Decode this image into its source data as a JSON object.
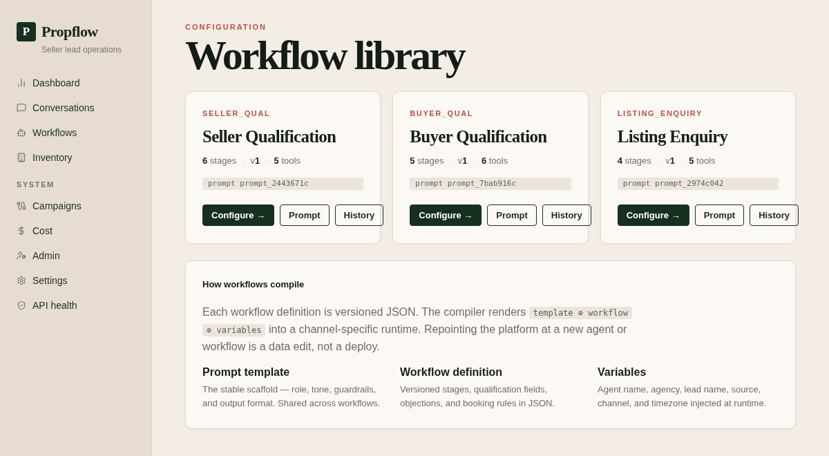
{
  "sidebar": {
    "brand": {
      "logo_letter": "P",
      "name": "Propflow",
      "tagline": "Seller lead operations"
    },
    "sections": [
      {
        "items": [
          {
            "label": "Dashboard",
            "selected": false
          },
          {
            "label": "Conversations",
            "selected": false
          },
          {
            "label": "Workflows",
            "selected": false
          },
          {
            "label": "Inventory",
            "selected": false
          }
        ]
      },
      {
        "heading": "SYSTEM",
        "items": [
          {
            "label": "Campaigns",
            "selected": false
          },
          {
            "label": "Cost",
            "selected": false
          },
          {
            "label": "Admin",
            "selected": false
          },
          {
            "label": "Settings",
            "selected": false
          },
          {
            "label": "API health",
            "selected": false
          }
        ]
      }
    ]
  },
  "header": {
    "eyebrow": "CONFIGURATION",
    "title": "Workflow library"
  },
  "workflows": [
    {
      "key": "SELLER_QUAL",
      "name": "Seller Qualification",
      "meta": [
        {
          "kind": "stat",
          "text": "**6** stages"
        },
        {
          "kind": "separator",
          "text": "·"
        },
        {
          "kind": "stat",
          "text": "v**1**"
        },
        {
          "kind": "separator",
          "text": "·"
        },
        {
          "kind": "stat",
          "text": "**5** tools"
        }
      ],
      "prompt": "prompt prompt_2443671c",
      "actions": [
        {
          "kind": "primary",
          "label": "Configure →"
        },
        {
          "kind": "secondary",
          "label": "Prompt"
        },
        {
          "kind": "secondary",
          "label": "History"
        }
      ]
    },
    {
      "key": "BUYER_QUAL",
      "name": "Buyer Qualification",
      "meta": [
        {
          "kind": "stat",
          "text": "**5** stages"
        },
        {
          "kind": "separator",
          "text": "·"
        },
        {
          "kind": "stat",
          "text": "v**1**"
        },
        {
          "kind": "separator",
          "text": "·"
        },
        {
          "kind": "stat",
          "text": "**6** tools"
        }
      ],
      "prompt": "prompt prompt_7bab916c",
      "actions": [
        {
          "kind": "primary",
          "label": "Configure →"
        },
        {
          "kind": "secondary",
          "label": "Prompt"
        },
        {
          "kind": "secondary",
          "label": "History"
        }
      ]
    },
    {
      "key": "LISTING_ENQUIRY",
      "name": "Listing Enquiry",
      "meta": [
        {
          "kind": "stat",
          "text": "**4** stages"
        },
        {
          "kind": "separator",
          "text": "·"
        },
        {
          "kind": "stat",
          "text": "v**1**"
        },
        {
          "kind": "separator",
          "text": "·"
        },
        {
          "kind": "stat",
          "text": "**5** tools"
        }
      ],
      "prompt": "prompt prompt_2974c042",
      "actions": [
        {
          "kind": "primary",
          "label": "Configure →"
        },
        {
          "kind": "secondary",
          "label": "Prompt"
        },
        {
          "kind": "secondary",
          "label": "History"
        }
      ]
    }
  ],
  "info": {
    "title": "How workflows compile",
    "body": [
      {
        "kind": "text",
        "text": "Each workflow definition is versioned JSON. The compiler renders "
      },
      {
        "kind": "code",
        "text": "template ⊕ workflow ⊕ variables"
      },
      {
        "kind": "text",
        "text": " into a channel-specific runtime. Repointing the platform at a new agent or workflow is a data edit, not a deploy."
      }
    ],
    "columns": [
      {
        "title": "Prompt template",
        "text": "The stable scaffold — role, tone, guardrails, and output format. Shared across workflows."
      },
      {
        "title": "Workflow definition",
        "text": "Versioned stages, qualification fields, objections, and booking rules in JSON."
      },
      {
        "title": "Variables",
        "text": "Agent name, agency, lead name, source, channel, and timezone injected at runtime."
      }
    ]
  }
}
